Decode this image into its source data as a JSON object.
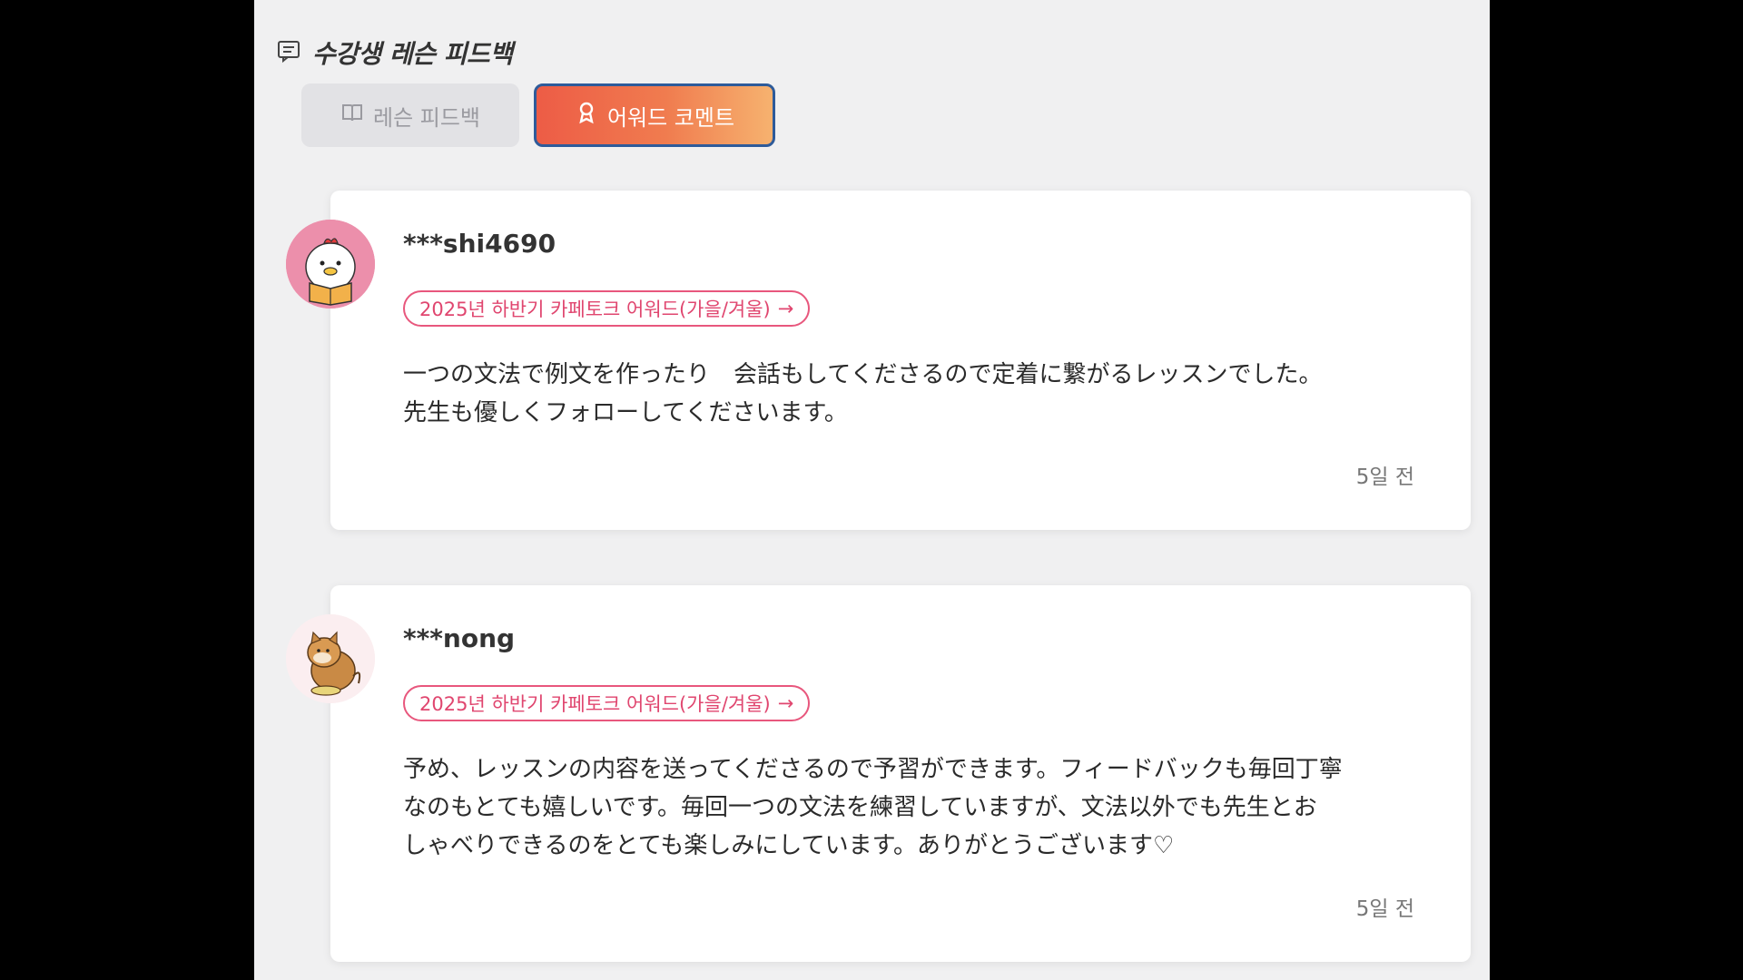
{
  "section": {
    "title": "수강생 레슨 피드백",
    "icon": "message-square-icon"
  },
  "tabs": [
    {
      "label": "레슨 피드백",
      "icon": "book-open-icon",
      "active": false
    },
    {
      "label": "어워드 코멘트",
      "icon": "award-icon",
      "active": true
    }
  ],
  "colors": {
    "active_tab_gradient_start": "#ed5c46",
    "active_tab_gradient_end": "#f6b26f",
    "badge": "#e0466f"
  },
  "feedbacks": [
    {
      "username": "***shi4690",
      "avatar": "chick-reading-avatar",
      "award": "2025년 하반기 카페토크 어워드(가을/겨울)",
      "arrow": "→",
      "comment": "一つの文法で例文を作ったり　会話もしてくださるので定着に繋がるレッスンでした。\n先生も優しくフォローしてくださいます。",
      "time": "5일 전"
    },
    {
      "username": "***nong",
      "avatar": "shiba-dog-avatar",
      "award": "2025년 하반기 카페토크 어워드(가을/겨울)",
      "arrow": "→",
      "comment": "予め、レッスンの内容を送ってくださるので予習ができます。フィードバックも毎回丁寧\nなのもとても嬉しいです。毎回一つの文法を練習していますが、文法以外でも先生とお\nしゃべりできるのをとても楽しみにしています。ありがとうございます♡",
      "time": "5일 전"
    }
  ]
}
